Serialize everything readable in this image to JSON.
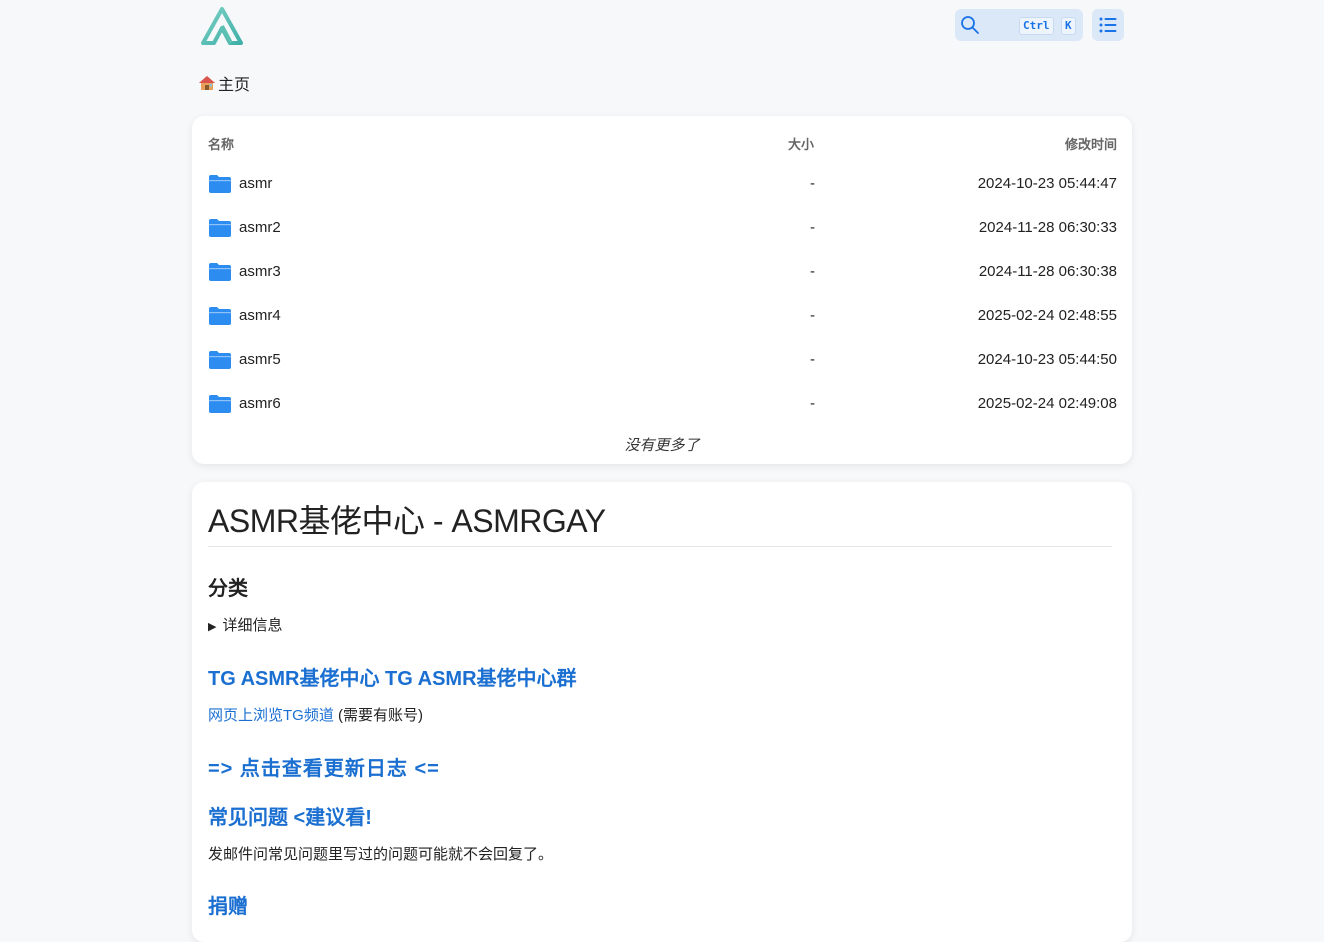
{
  "header": {
    "search": {
      "key_ctrl": "Ctrl",
      "key_k": "K"
    }
  },
  "breadcrumb": {
    "home": "主页"
  },
  "file_list": {
    "columns": {
      "name": "名称",
      "size": "大小",
      "modified": "修改时间"
    },
    "rows": [
      {
        "name": "asmr",
        "size": "-",
        "modified": "2024-10-23 05:44:47"
      },
      {
        "name": "asmr2",
        "size": "-",
        "modified": "2024-11-28 06:30:33"
      },
      {
        "name": "asmr3",
        "size": "-",
        "modified": "2024-11-28 06:30:38"
      },
      {
        "name": "asmr4",
        "size": "-",
        "modified": "2025-02-24 02:48:55"
      },
      {
        "name": "asmr5",
        "size": "-",
        "modified": "2024-10-23 05:44:50"
      },
      {
        "name": "asmr6",
        "size": "-",
        "modified": "2025-02-24 02:49:08"
      }
    ],
    "end_text": "没有更多了"
  },
  "readme": {
    "title": "ASMR基佬中心 - ASMRGAY",
    "category_heading": "分类",
    "details_summary": "详细信息",
    "tg_link_1": "TG ASMR基佬中心",
    "tg_link_2": "TG ASMR基佬中心群",
    "web_tg_link": "网页上浏览TG频道",
    "web_tg_note": " (需要有账号)",
    "changelog_link": "=> 点击查看更新日志 <=",
    "faq_link": "常见问题 <建议看!",
    "faq_note": "发邮件问常见问题里写过的问题可能就不会回复了。",
    "donate_link": "捐赠"
  },
  "colors": {
    "accent": "#1a6fd1",
    "folder": "#2d8cf0",
    "background": "#f7f8fa",
    "logo": "#5cc1b3"
  },
  "icons": {
    "logo": "alist-logo-icon",
    "search": "search-icon",
    "list": "list-icon",
    "home": "house-icon",
    "folder": "folder-icon"
  }
}
